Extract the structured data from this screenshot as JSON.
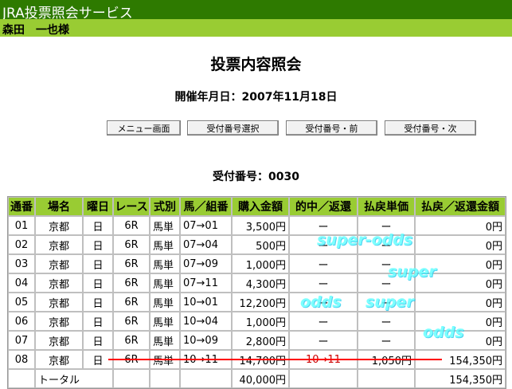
{
  "app": {
    "title": "JRA投票照会サービス",
    "user": "森田　一也様"
  },
  "page": {
    "title": "投票内容照会",
    "meet_date": "開催年月日：2007年11月18日",
    "receipt_no": "受付番号：0030"
  },
  "buttons": {
    "menu": "メニュー画面",
    "select": "受付番号選択",
    "prev": "受付番号・前",
    "next": "受付番号・次"
  },
  "table": {
    "headers": [
      "通番",
      "場名",
      "曜日",
      "レース",
      "式別",
      "馬／組番",
      "購入金額",
      "的中／返還",
      "払戻単価",
      "払戻／返還金額"
    ],
    "rows": [
      [
        "01",
        "京都",
        "日",
        "6R",
        "馬単",
        "07→01",
        "3,500円",
        "ー",
        "ー",
        "0円"
      ],
      [
        "02",
        "京都",
        "日",
        "6R",
        "馬単",
        "07→04",
        "500円",
        "ー",
        "ー",
        "0円"
      ],
      [
        "03",
        "京都",
        "日",
        "6R",
        "馬単",
        "07→09",
        "1,000円",
        "ー",
        "ー",
        "0円"
      ],
      [
        "04",
        "京都",
        "日",
        "6R",
        "馬単",
        "07→11",
        "4,300円",
        "ー",
        "ー",
        "0円"
      ],
      [
        "05",
        "京都",
        "日",
        "6R",
        "馬単",
        "10→01",
        "12,200円",
        "ー",
        "ー",
        "0円"
      ],
      [
        "06",
        "京都",
        "日",
        "6R",
        "馬単",
        "10→04",
        "1,000円",
        "ー",
        "ー",
        "0円"
      ],
      [
        "07",
        "京都",
        "日",
        "6R",
        "馬単",
        "10→09",
        "2,800円",
        "ー",
        "ー",
        "0円"
      ],
      [
        "08",
        "京都",
        "日",
        "6R",
        "馬単",
        "10→11",
        "14,700円",
        "10→11",
        "1,050円",
        "154,350円"
      ]
    ],
    "total": {
      "label": "トータル",
      "purchase": "40,000円",
      "payout": "154,350円"
    }
  },
  "watermarks": [
    "super-odds",
    "super",
    "odds",
    "super",
    "odds"
  ],
  "colors": {
    "appbar": "#2e7a00",
    "userbar": "#99cc33",
    "header": "#99cc33",
    "hit": "#cc0000",
    "underline": "#ff0000",
    "watermark": "#66ffff"
  }
}
